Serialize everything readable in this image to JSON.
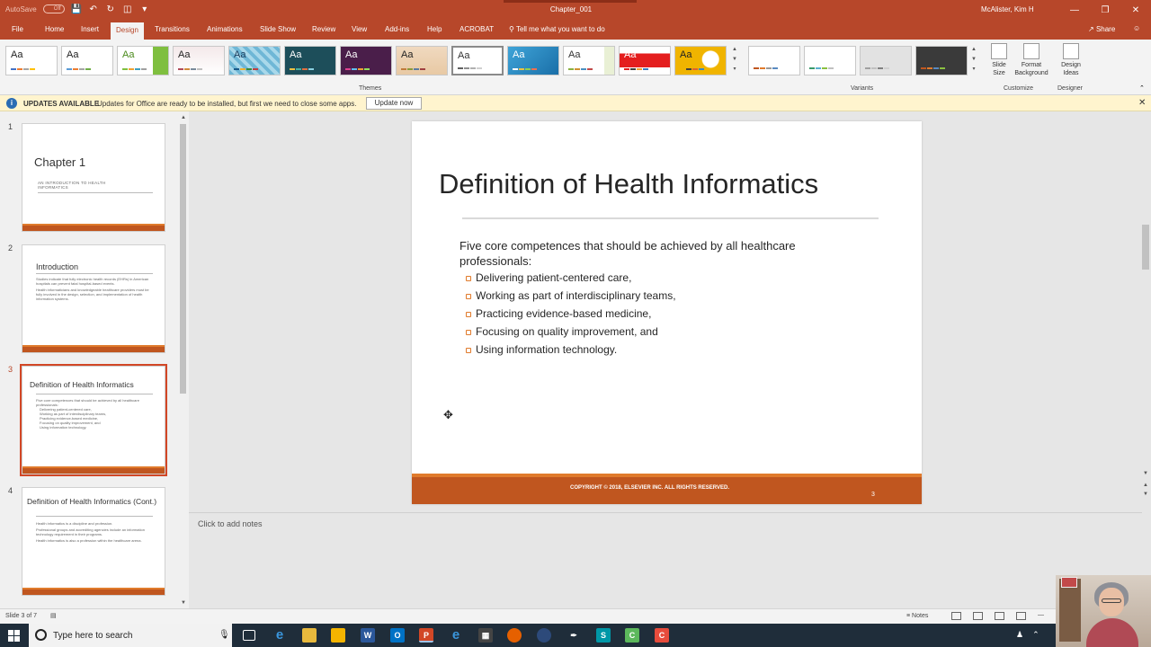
{
  "titlebar": {
    "autosave_label": "AutoSave",
    "autosave_state": "Off",
    "document_title": "Chapter_001",
    "user_name": "McAlister, Kim H",
    "accent_color": "#b7472a"
  },
  "ribbon_tabs": [
    "File",
    "Home",
    "Insert",
    "Design",
    "Transitions",
    "Animations",
    "Slide Show",
    "Review",
    "View",
    "Add-ins",
    "Help",
    "ACROBAT"
  ],
  "active_tab": "Design",
  "tell_me": "Tell me what you want to do",
  "share_label": "Share",
  "ribbon": {
    "themes_label": "Themes",
    "variants_label": "Variants",
    "customize_label": "Customize",
    "designer_label": "Designer",
    "theme_preview_text": "Aa",
    "slide_size_label": "Slide Size",
    "format_background_label": "Format Background",
    "design_ideas_label": "Design Ideas"
  },
  "update_bar": {
    "title": "UPDATES AVAILABLE",
    "message": "Updates for Office are ready to be installed, but first we need to close some apps.",
    "button": "Update now"
  },
  "slides": [
    {
      "number": "1",
      "title": "Chapter 1",
      "subtitle": "AN INTRODUCTION TO HEALTH INFORMATICS",
      "body": []
    },
    {
      "number": "2",
      "title": "Introduction",
      "subtitle": "",
      "body": [
        "Studies indicate that fully electronic health records (EHRs) in American hospitals can prevent fatal hospital-based events.",
        "Health informaticians and knowledgeable healthcare providers must be fully involved in the design, selection, and implementation of health information systems."
      ]
    },
    {
      "number": "3",
      "title": "Definition of Health Informatics",
      "subtitle": "",
      "body": [
        "Five core competences that should be achieved by all healthcare professionals:",
        "Delivering patient-centered care,",
        "Working as part of interdisciplinary teams,",
        "Practicing evidence-based medicine,",
        "Focusing on quality improvement, and",
        "Using information technology."
      ]
    },
    {
      "number": "4",
      "title": "Definition of Health Informatics (Cont.)",
      "subtitle": "",
      "body": [
        "Health informatics is a discipline and profession.",
        "Professional groups and accrediting agencies include an information technology requirement in their programs.",
        "Health informatics is also a profession within the healthcare arena."
      ]
    }
  ],
  "current_slide": {
    "title": "Definition of Health Informatics",
    "intro": "Five core competences that should be achieved by all healthcare professionals:",
    "bullets": [
      "Delivering patient-centered care,",
      "Working as part of interdisciplinary teams,",
      "Practicing evidence-based medicine,",
      "Focusing on quality improvement, and",
      "Using information technology."
    ],
    "footer": "COPYRIGHT © 2018, ELSEVIER INC. ALL RIGHTS RESERVED.",
    "page_number": "3"
  },
  "notes_placeholder": "Click to add notes",
  "status": {
    "slide_count": "Slide 3 of 7",
    "notes_label": "Notes"
  },
  "taskbar": {
    "search_placeholder": "Type here to search"
  }
}
